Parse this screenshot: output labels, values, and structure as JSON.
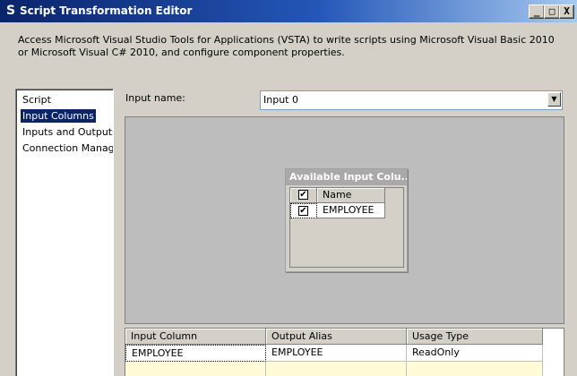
{
  "window": {
    "title": "Script Transformation Editor",
    "minimize_glyph": "_",
    "maximize_glyph": "□",
    "close_glyph": "X",
    "app_icon_glyph": "S"
  },
  "description": "Access Microsoft Visual Studio Tools for Applications (VSTA) to write scripts using Microsoft Visual Basic 2010 or Microsoft Visual C# 2010, and configure component properties.",
  "nav": {
    "items": [
      {
        "label": "Script"
      },
      {
        "label": "Input Columns"
      },
      {
        "label": "Inputs and Outputs"
      },
      {
        "label": "Connection Managers"
      }
    ],
    "selected": "Input Columns"
  },
  "input": {
    "label": "Input name:",
    "value": "Input 0",
    "arrow_glyph": "▼"
  },
  "available_columns": {
    "title": "Available Input Colu...",
    "header": "Name",
    "check_glyph": "✔",
    "rows": [
      {
        "name": "EMPLOYEE",
        "checked": true
      }
    ]
  },
  "mapping_table": {
    "columns": [
      "Input Column",
      "Output Alias",
      "Usage Type"
    ],
    "rows": [
      [
        "EMPLOYEE",
        "EMPLOYEE",
        "ReadOnly"
      ]
    ]
  },
  "colors": {
    "titlebar_start": "#0a246a",
    "selection": "#0a246a",
    "dialog_bg": "#d4d0c8",
    "canvas_bg": "#bdbdbd",
    "new_row": "#fffbd6"
  }
}
